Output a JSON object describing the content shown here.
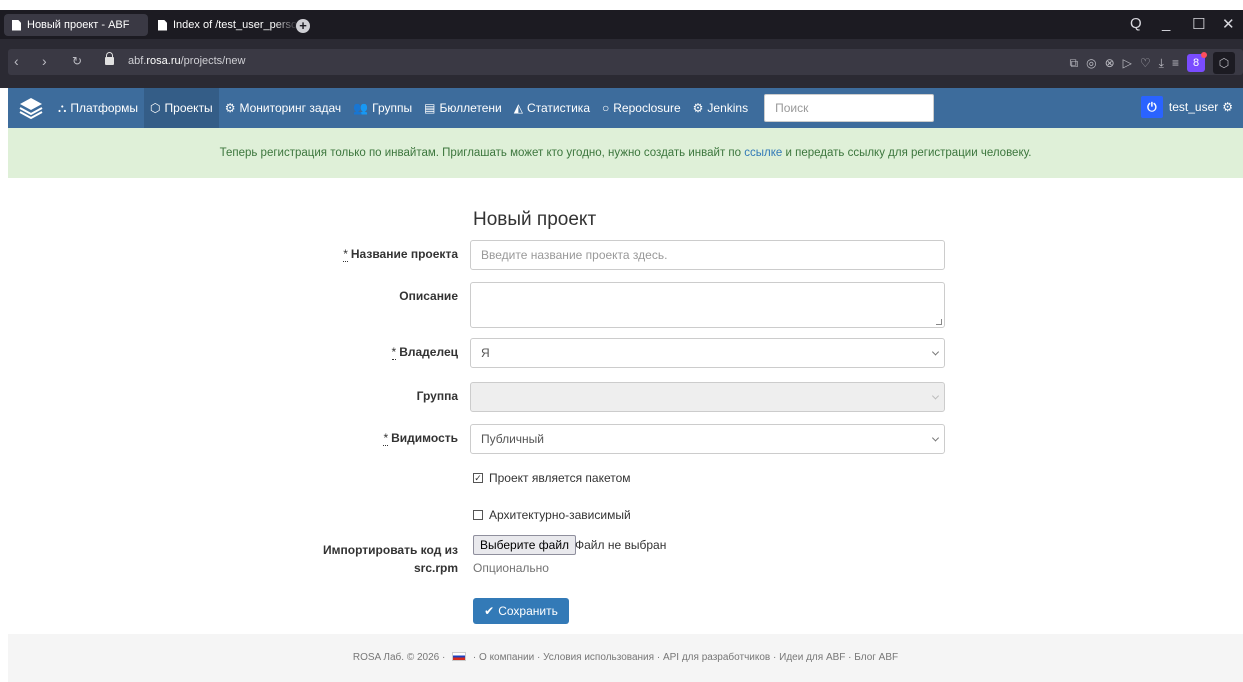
{
  "browser": {
    "tabs": [
      {
        "title": "Новый проект - ABF",
        "active": true
      },
      {
        "title": "Index of /test_user_person",
        "active": false
      }
    ],
    "new_tab_icon": "plus-icon",
    "address": {
      "prefix": "abf.",
      "host": "rosa.ru",
      "path": "/projects/new"
    },
    "window_controls": {
      "search": "Q",
      "minimize": "_",
      "maximize": "☐",
      "close": "✕"
    },
    "toolbar_icons": [
      "screenshot-icon",
      "camera-icon",
      "shield-icon",
      "play-icon",
      "heart-icon",
      "download-icon",
      "menu-icon",
      "extension-icon",
      "cube-icon"
    ],
    "extension_badge": "8"
  },
  "navbar": {
    "items": [
      {
        "label": "Платформы",
        "icon": "platforms-icon",
        "glyph": "⛬"
      },
      {
        "label": "Проекты",
        "icon": "projects-icon",
        "glyph": "⬡",
        "active": true
      },
      {
        "label": "Мониторинг задач",
        "icon": "cogs-icon",
        "glyph": "⚙"
      },
      {
        "label": "Группы",
        "icon": "group-icon",
        "glyph": "👥"
      },
      {
        "label": "Бюллетени",
        "icon": "newspaper-icon",
        "glyph": "▤"
      },
      {
        "label": "Статистика",
        "icon": "area-chart-icon",
        "glyph": "◭"
      },
      {
        "label": "Repoclosure",
        "icon": "circle-icon",
        "glyph": "○"
      },
      {
        "label": "Jenkins",
        "icon": "cogs-icon",
        "glyph": "⚙"
      }
    ],
    "search_placeholder": "Поиск",
    "user": "test_user"
  },
  "alert": {
    "before": "Теперь регистрация только по инвайтам. Приглашать может кто угодно, нужно создать инвайт по ",
    "link": "ссылке",
    "after": " и передать ссылку для регистрации человеку."
  },
  "form": {
    "title": "Новый проект",
    "required_mark": "*",
    "name_label": "Название проекта",
    "name_placeholder": "Введите название проекта здесь.",
    "description_label": "Описание",
    "owner_label": "Владелец",
    "owner_value": "Я",
    "group_label": "Группа",
    "visibility_label": "Видимость",
    "visibility_value": "Публичный",
    "is_package_label": "Проект является пакетом",
    "is_package_checked": true,
    "arch_dependent_label": "Архитектурно-зависимый",
    "arch_dependent_checked": false,
    "import_label_line1": "Импортировать код из",
    "import_label_line2": "src.rpm",
    "file_button": "Выберите файл",
    "file_status": "Файл не выбран",
    "import_help": "Опционально",
    "save_button": "Сохранить"
  },
  "footer": {
    "copyright": "ROSA Лаб. © 2026",
    "links": [
      "О компании",
      "Условия использования",
      "API для разработчиков",
      "Идеи для ABF",
      "Блог ABF"
    ],
    "separator": " · "
  }
}
